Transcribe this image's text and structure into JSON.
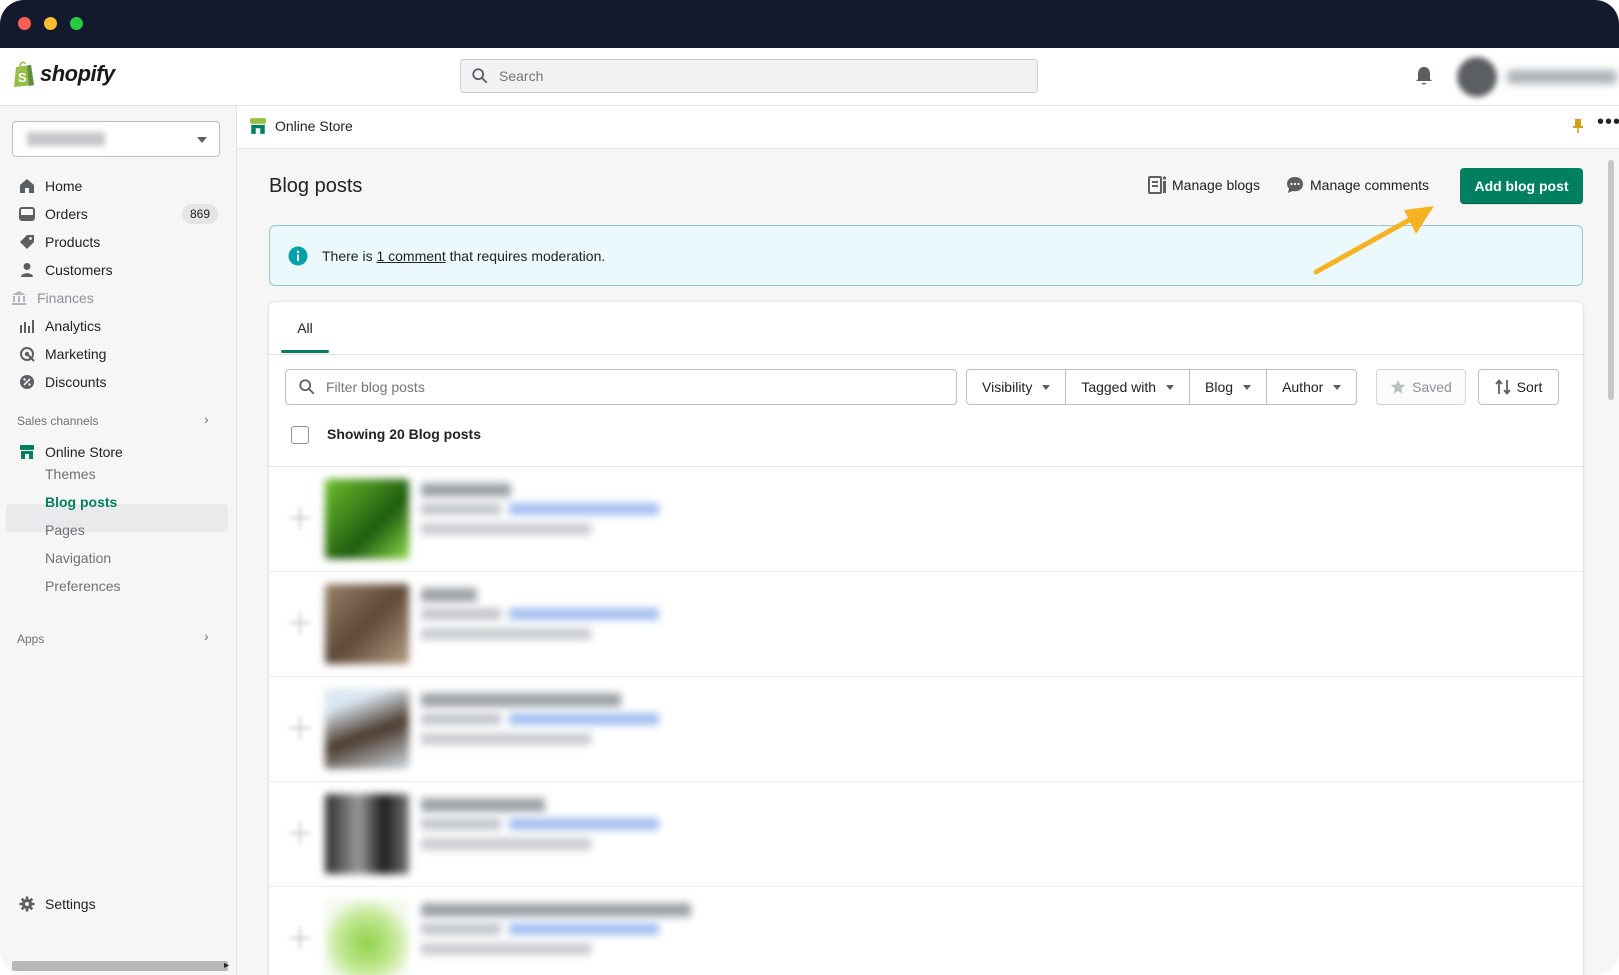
{
  "topbar": {
    "logo_text": "shopify",
    "search_placeholder": "Search"
  },
  "sidebar": {
    "nav": [
      {
        "label": "Home",
        "icon": "home-icon"
      },
      {
        "label": "Orders",
        "icon": "orders-icon",
        "badge": "869"
      },
      {
        "label": "Products",
        "icon": "tag-icon"
      },
      {
        "label": "Customers",
        "icon": "person-icon"
      },
      {
        "label": "Finances",
        "icon": "bank-icon",
        "disabled": true
      },
      {
        "label": "Analytics",
        "icon": "bar-chart-icon"
      },
      {
        "label": "Marketing",
        "icon": "target-icon"
      },
      {
        "label": "Discounts",
        "icon": "discount-icon"
      }
    ],
    "sales_channels_label": "Sales channels",
    "online_store_label": "Online Store",
    "sub_items": [
      "Themes",
      "Blog posts",
      "Pages",
      "Navigation",
      "Preferences"
    ],
    "active_sub_item": "Blog posts",
    "apps_label": "Apps",
    "settings_label": "Settings"
  },
  "breadcrumb": {
    "label": "Online Store"
  },
  "page": {
    "title": "Blog posts",
    "manage_blogs": "Manage blogs",
    "manage_comments": "Manage comments",
    "add_button": "Add blog post"
  },
  "banner": {
    "text_before": "There is ",
    "link_text": "1 comment",
    "text_after": " that requires moderation."
  },
  "list": {
    "tab": "All",
    "filter_placeholder": "Filter blog posts",
    "filters": [
      "Visibility",
      "Tagged with",
      "Blog",
      "Author"
    ],
    "saved_label": "Saved",
    "sort_label": "Sort",
    "showing_text": "Showing 20 Blog posts"
  },
  "colors": {
    "primary": "#008060",
    "annotation_arrow": "#f5b324",
    "banner_bg": "#ebf9fc",
    "info_icon": "#00a0ac"
  }
}
